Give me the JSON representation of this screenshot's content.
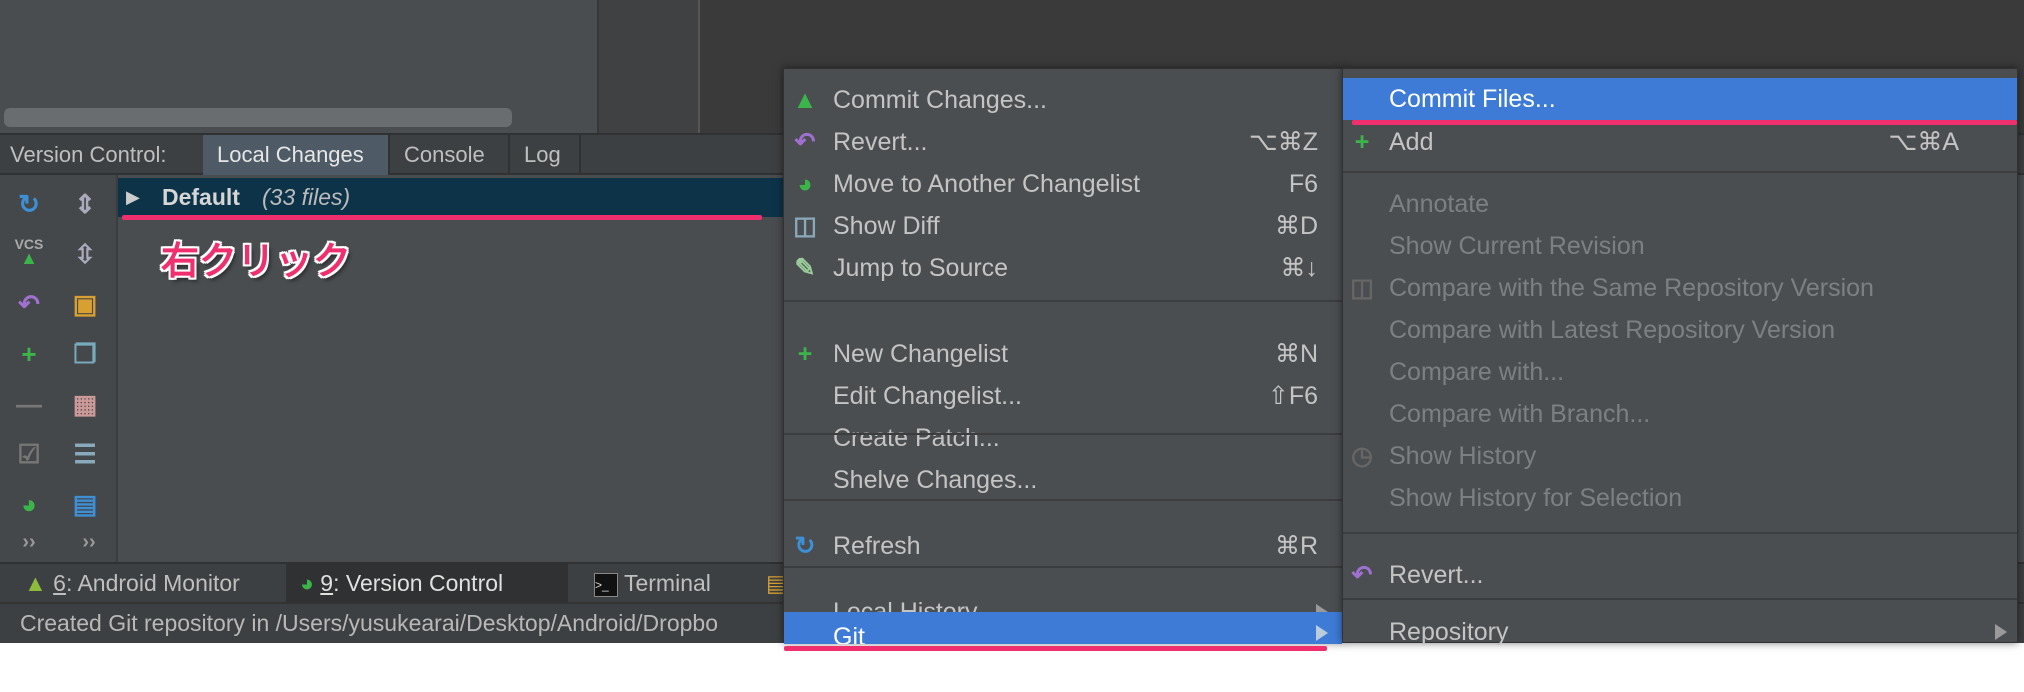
{
  "colors": {
    "accent": "#3d7bd6",
    "selection_row": "#0d3349",
    "annotation": "#f0306e"
  },
  "tabbar": {
    "label": "Version Control:",
    "tabs": [
      {
        "label": "Local Changes",
        "active": true
      },
      {
        "label": "Console"
      },
      {
        "label": "Log"
      }
    ]
  },
  "toolbar": {
    "icons": [
      "refresh-icon",
      "expand-all-icon",
      "vcs-commit-icon",
      "collapse-all-icon",
      "revert-icon",
      "shelf-icon",
      "add-icon",
      "copy-icon",
      "remove-icon",
      "group-icon",
      "checkbox-icon",
      "checklist-icon",
      "move-changelist-icon",
      "preview-icon",
      "more-icon",
      "more-icon"
    ],
    "more": "››"
  },
  "changelist": {
    "name": "Default",
    "count": "(33 files)"
  },
  "annotation": "右クリック",
  "bottombar": [
    {
      "num": "6",
      "label": ": Android Monitor"
    },
    {
      "num": "9",
      "label": ": Version Control",
      "active": true
    },
    {
      "label": "Terminal"
    }
  ],
  "status": "Created Git repository in /Users/yusukearai/Desktop/Android/Dropbo",
  "menu1": [
    {
      "label": "Commit Changes...",
      "icon": "vcs-commit-icon"
    },
    {
      "label": "Revert...",
      "shortcut": "⌥⌘Z",
      "icon": "revert-icon"
    },
    {
      "label": "Move to Another Changelist",
      "shortcut": "F6",
      "icon": "move-changelist-icon"
    },
    {
      "label": "Show Diff",
      "shortcut": "⌘D",
      "icon": "diff-icon"
    },
    {
      "label": "Jump to Source",
      "shortcut": "⌘↓",
      "icon": "edit-source-icon"
    },
    {
      "label": "New Changelist",
      "shortcut": "⌘N",
      "icon": "add-icon"
    },
    {
      "label": "Edit Changelist...",
      "shortcut": "⇧F6"
    },
    {
      "label": "Create Patch..."
    },
    {
      "label": "Shelve Changes..."
    },
    {
      "label": "Refresh",
      "shortcut": "⌘R",
      "icon": "refresh-icon"
    },
    {
      "label": "Local History",
      "submenu": true
    },
    {
      "label": "Git",
      "submenu": true,
      "selected": true
    }
  ],
  "menu2": [
    {
      "label": "Commit Files...",
      "selected": true
    },
    {
      "label": "Add",
      "shortcut": "⌥⌘A",
      "icon": "add-icon"
    },
    {
      "label": "Annotate",
      "disabled": true
    },
    {
      "label": "Show Current Revision",
      "disabled": true
    },
    {
      "label": "Compare with the Same Repository Version",
      "disabled": true,
      "icon": "diff-icon"
    },
    {
      "label": "Compare with Latest Repository Version",
      "disabled": true
    },
    {
      "label": "Compare with...",
      "disabled": true
    },
    {
      "label": "Compare with Branch...",
      "disabled": true
    },
    {
      "label": "Show History",
      "disabled": true,
      "icon": "history-icon"
    },
    {
      "label": "Show History for Selection",
      "disabled": true
    },
    {
      "label": "Revert...",
      "icon": "revert-icon"
    },
    {
      "label": "Repository",
      "submenu": true
    }
  ]
}
